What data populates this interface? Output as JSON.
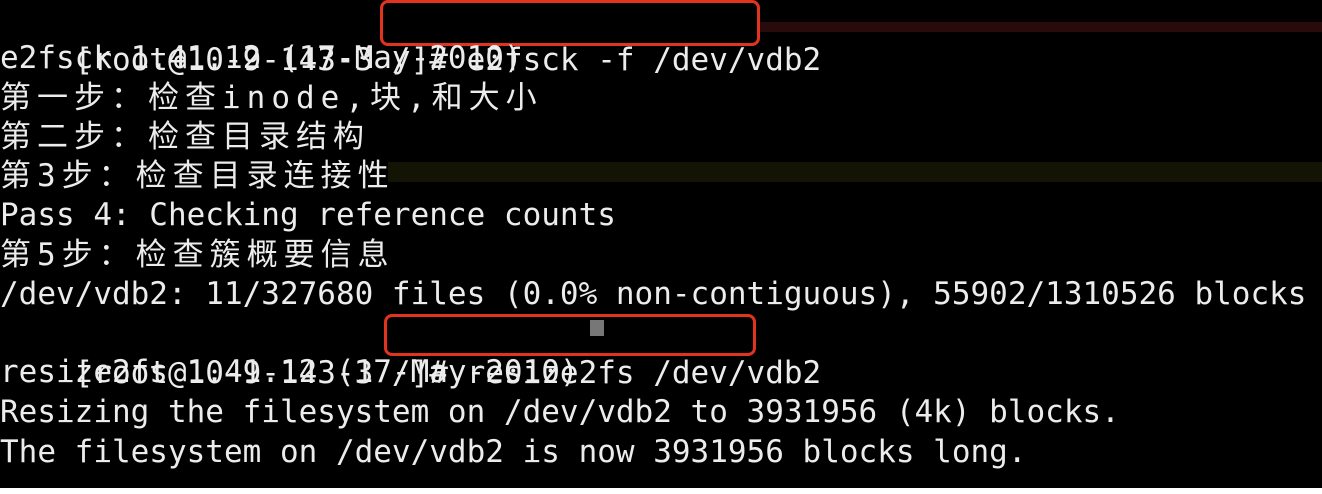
{
  "terminal": {
    "colors": {
      "background": "#000000",
      "text": "#ececec",
      "highlight_box": "#e2331f"
    },
    "session1": {
      "prompt": "[root@10-9-143-3 /]# ",
      "command": "e2fsck -f /dev/vdb2"
    },
    "output1": [
      "e2fsck 1.41.12 (17-May-2010)",
      "第一步：检查inode,块,和大小",
      "第二步：检查目录结构",
      "第3步：检查目录连接性",
      "Pass 4: Checking reference counts",
      "第5步：检查簇概要信息",
      "/dev/vdb2: 11/327680 files (0.0% non-contiguous), 55902/1310526 blocks"
    ],
    "session2": {
      "prompt": "[root@10-9-143-3 /]# ",
      "command": "resize2fs /dev/vdb2"
    },
    "output2": [
      "resize2fs 1.41.12 (17-May-2010)",
      "Resizing the filesystem on /dev/vdb2 to 3931956 (4k) blocks.",
      "The filesystem on /dev/vdb2 is now 3931956 blocks long."
    ]
  }
}
